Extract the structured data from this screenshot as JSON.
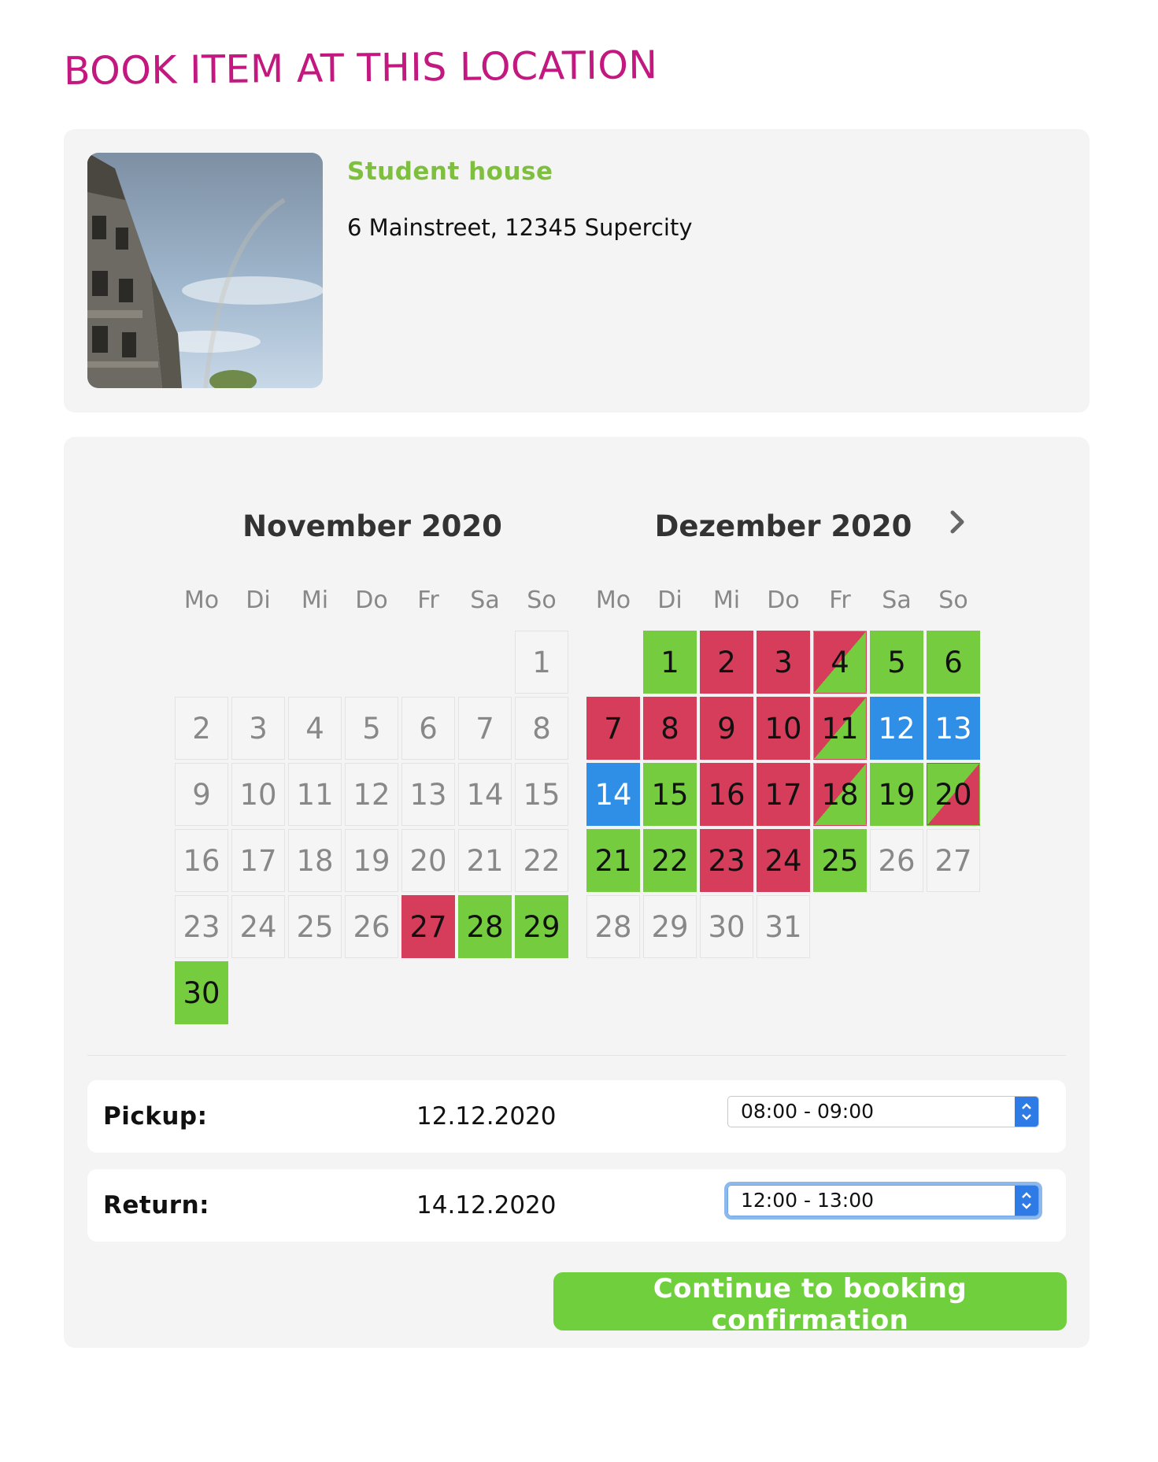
{
  "page": {
    "heading": "BOOK ITEM AT THIS LOCATION"
  },
  "location": {
    "name": "Student house",
    "address": "6 Mainstreet, 12345 Supercity",
    "photo_icon": "building-photo"
  },
  "calendar": {
    "next_icon": "chevron-right-icon",
    "weekdays": [
      "Mo",
      "Di",
      "Mi",
      "Do",
      "Fr",
      "Sa",
      "So"
    ],
    "months": [
      {
        "title": "November 2020",
        "first_weekday": 6,
        "days": [
          {
            "d": "1",
            "s": "none"
          },
          {
            "d": "2",
            "s": "none"
          },
          {
            "d": "3",
            "s": "none"
          },
          {
            "d": "4",
            "s": "none"
          },
          {
            "d": "5",
            "s": "none"
          },
          {
            "d": "6",
            "s": "none"
          },
          {
            "d": "7",
            "s": "none"
          },
          {
            "d": "8",
            "s": "none"
          },
          {
            "d": "9",
            "s": "none"
          },
          {
            "d": "10",
            "s": "none"
          },
          {
            "d": "11",
            "s": "none"
          },
          {
            "d": "12",
            "s": "none"
          },
          {
            "d": "13",
            "s": "none"
          },
          {
            "d": "14",
            "s": "none"
          },
          {
            "d": "15",
            "s": "none"
          },
          {
            "d": "16",
            "s": "none"
          },
          {
            "d": "17",
            "s": "none"
          },
          {
            "d": "18",
            "s": "none"
          },
          {
            "d": "19",
            "s": "none"
          },
          {
            "d": "20",
            "s": "none"
          },
          {
            "d": "21",
            "s": "none"
          },
          {
            "d": "22",
            "s": "none"
          },
          {
            "d": "23",
            "s": "none"
          },
          {
            "d": "24",
            "s": "none"
          },
          {
            "d": "25",
            "s": "none"
          },
          {
            "d": "26",
            "s": "none"
          },
          {
            "d": "27",
            "s": "red"
          },
          {
            "d": "28",
            "s": "green"
          },
          {
            "d": "29",
            "s": "green"
          },
          {
            "d": "30",
            "s": "green"
          }
        ]
      },
      {
        "title": "Dezember 2020",
        "first_weekday": 1,
        "days": [
          {
            "d": "1",
            "s": "green"
          },
          {
            "d": "2",
            "s": "red"
          },
          {
            "d": "3",
            "s": "red"
          },
          {
            "d": "4",
            "s": "red-green"
          },
          {
            "d": "5",
            "s": "green"
          },
          {
            "d": "6",
            "s": "green"
          },
          {
            "d": "7",
            "s": "red"
          },
          {
            "d": "8",
            "s": "red"
          },
          {
            "d": "9",
            "s": "red"
          },
          {
            "d": "10",
            "s": "red"
          },
          {
            "d": "11",
            "s": "red-green"
          },
          {
            "d": "12",
            "s": "blue"
          },
          {
            "d": "13",
            "s": "blue"
          },
          {
            "d": "14",
            "s": "blue"
          },
          {
            "d": "15",
            "s": "green"
          },
          {
            "d": "16",
            "s": "red"
          },
          {
            "d": "17",
            "s": "red"
          },
          {
            "d": "18",
            "s": "red-green"
          },
          {
            "d": "19",
            "s": "green"
          },
          {
            "d": "20",
            "s": "green-red"
          },
          {
            "d": "21",
            "s": "green"
          },
          {
            "d": "22",
            "s": "green"
          },
          {
            "d": "23",
            "s": "red"
          },
          {
            "d": "24",
            "s": "red"
          },
          {
            "d": "25",
            "s": "green"
          },
          {
            "d": "26",
            "s": "none"
          },
          {
            "d": "27",
            "s": "none"
          },
          {
            "d": "28",
            "s": "none"
          },
          {
            "d": "29",
            "s": "none"
          },
          {
            "d": "30",
            "s": "none"
          },
          {
            "d": "31",
            "s": "none"
          }
        ]
      }
    ],
    "colors": {
      "available": "#75cc3f",
      "booked": "#d63d5a",
      "selected": "#2f8ee6"
    }
  },
  "pickup": {
    "label": "Pickup:",
    "date": "12.12.2020",
    "time": "08:00 - 09:00"
  },
  "return": {
    "label": "Return:",
    "date": "14.12.2020",
    "time": "12:00 - 13:00"
  },
  "actions": {
    "continue_label": "Continue to booking confirmation"
  }
}
